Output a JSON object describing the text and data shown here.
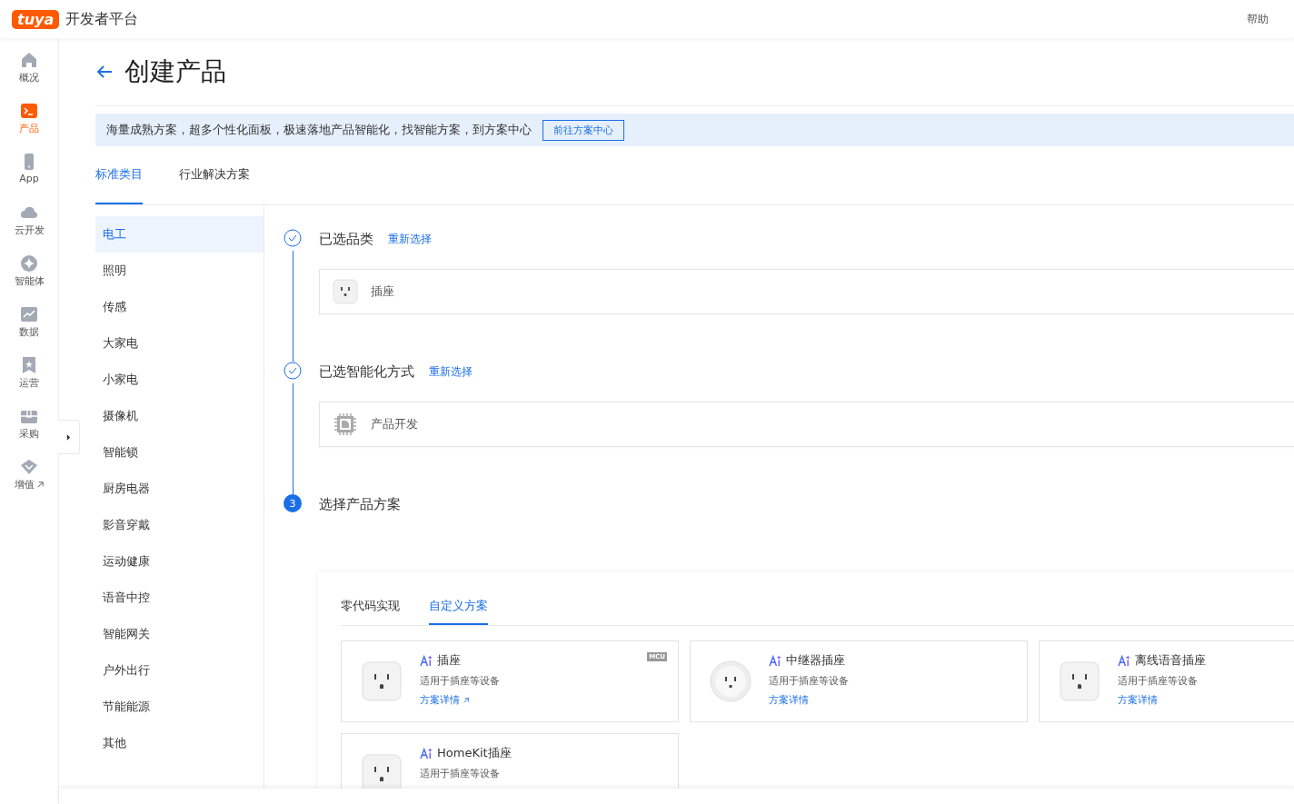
{
  "header": {
    "logo": "tuya",
    "title": "开发者平台",
    "help": "帮助"
  },
  "nav": [
    {
      "label": "概况",
      "selected": false
    },
    {
      "label": "产品",
      "selected": true
    },
    {
      "label": "App",
      "selected": false
    },
    {
      "label": "云开发",
      "selected": false
    },
    {
      "label": "智能体",
      "selected": false
    },
    {
      "label": "数据",
      "selected": false
    },
    {
      "label": "运营",
      "selected": false
    },
    {
      "label": "采购",
      "selected": false
    },
    {
      "label": "增值",
      "selected": false,
      "external": true
    }
  ],
  "page": {
    "title": "创建产品"
  },
  "banner": {
    "text": "海量成熟方案，超多个性化面板，极速落地产品智能化，找智能方案，到方案中心",
    "button": "前往方案中心"
  },
  "tabs": [
    {
      "label": "标准类目",
      "selected": true
    },
    {
      "label": "行业解决方案",
      "selected": false
    }
  ],
  "categories": [
    {
      "label": "电工",
      "selected": true
    },
    {
      "label": "照明",
      "selected": false
    },
    {
      "label": "传感",
      "selected": false
    },
    {
      "label": "大家电",
      "selected": false
    },
    {
      "label": "小家电",
      "selected": false
    },
    {
      "label": "摄像机",
      "selected": false
    },
    {
      "label": "智能锁",
      "selected": false
    },
    {
      "label": "厨房电器",
      "selected": false
    },
    {
      "label": "影音穿戴",
      "selected": false
    },
    {
      "label": "运动健康",
      "selected": false
    },
    {
      "label": "语音中控",
      "selected": false
    },
    {
      "label": "智能网关",
      "selected": false
    },
    {
      "label": "户外出行",
      "selected": false
    },
    {
      "label": "节能能源",
      "selected": false
    },
    {
      "label": "其他",
      "selected": false
    }
  ],
  "steps": [
    {
      "title": "已选品类",
      "done": true,
      "link": "重新选择",
      "choice": {
        "kind": "socket",
        "label": "插座"
      }
    },
    {
      "title": "已选智能化方式",
      "done": true,
      "link": "重新选择",
      "choice": {
        "kind": "chip",
        "label": "产品开发"
      }
    },
    {
      "title": "选择产品方案",
      "done": false,
      "number": "3"
    }
  ],
  "solution_tabs": [
    {
      "label": "零代码实现",
      "selected": false
    },
    {
      "label": "自定义方案",
      "selected": true
    }
  ],
  "solutions": [
    {
      "name": "插座",
      "desc": "适用于插座等设备",
      "link": "方案详情",
      "external": true,
      "badge": "MCU",
      "kind": "square"
    },
    {
      "name": "中继器插座",
      "desc": "适用于插座等设备",
      "link": "方案详情",
      "external": false,
      "kind": "round"
    },
    {
      "name": "离线语音插座",
      "desc": "适用于插座等设备",
      "link": "方案详情",
      "external": false,
      "kind": "square"
    },
    {
      "name": "HomeKit插座",
      "desc": "适用于插座等设备",
      "kind": "square"
    }
  ]
}
